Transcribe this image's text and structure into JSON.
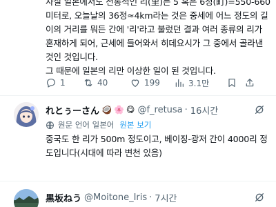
{
  "post1": {
    "lines": [
      "사실 일본에서도 전통적인 리(里)는 5 혹은 6정(町)=550-660",
      "미터로, 오늘날의 36정≈4km라는 것은 중세에 어느 정도의 길",
      "이의 거리를 뭐든 간에 '리'라고 불렀던 결과 여러 종류의 리가",
      "혼재하게 되어, 근세에 들어와서 히데요시가 그 중에서 골라낸",
      "것인 것입니다.",
      "그 때문에 일본의 리만 이상한 일이 된 것입니다."
    ],
    "actions": {
      "reply_count": "1",
      "repost_count": "40",
      "like_count": "199",
      "view_count": "3.1만"
    }
  },
  "post2": {
    "display_name": "れとぅーさん",
    "emojis": [
      "🥥",
      "🌸",
      "😋"
    ],
    "handle": "@f_retusa",
    "separator": "·",
    "time": "16시간",
    "translation": {
      "note": "원문 언어 일본어",
      "link": "원본 보기"
    },
    "lines": [
      "중국도 한 리가 500m 정도이고, 베이징-광저 간이 4000리 정",
      "도입니다(시대에 따라 변천 있음)"
    ]
  },
  "post3": {
    "display_name": "黒坂ねう",
    "handle": "@Moitone_Iris",
    "separator": "·",
    "time": "7시간"
  },
  "colors": {
    "text": "#0f1419",
    "muted": "#536471",
    "link": "#1d9bf0",
    "divider": "#eff3f4"
  },
  "icons": [
    "reply-icon",
    "repost-icon",
    "like-icon",
    "views-icon",
    "bookmark-icon",
    "share-icon",
    "grok-icon",
    "translate-icon"
  ]
}
